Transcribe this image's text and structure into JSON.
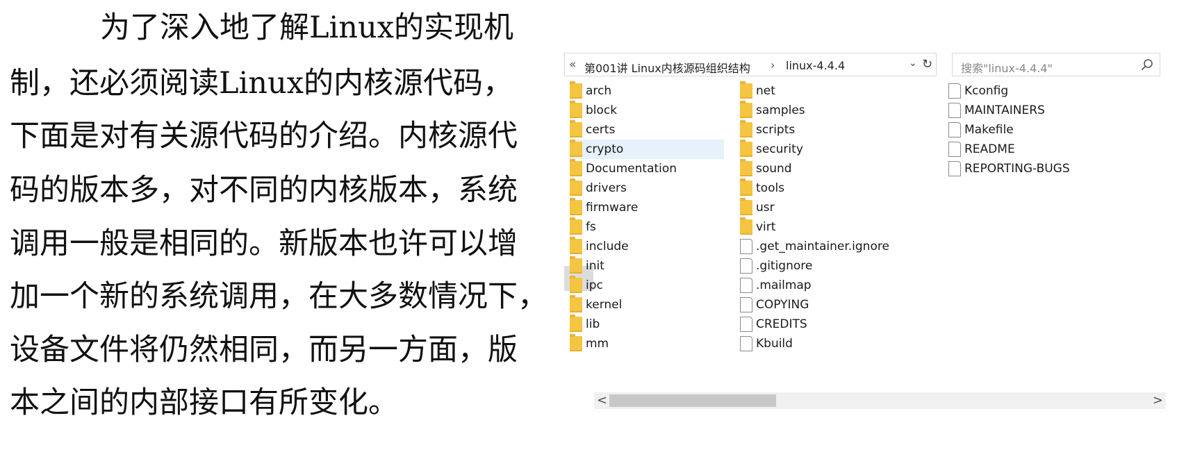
{
  "paragraph": {
    "lines": [
      "为了深入地了解Linux的实现机",
      "制，还必须阅读Linux的内核源代码，",
      "下面是对有关源代码的介绍。内核源代",
      "码的版本多，对不同的内核版本，系统",
      "调用一般是相同的。新版本也许可以增",
      "加一个新的系统调用，在大多数情况下，",
      "设备文件将仍然相同，而另一方面，版",
      "本之间的内部接口有所变化。"
    ]
  },
  "explorer": {
    "addressbar": {
      "overflow": "«",
      "crumbs": [
        "第001讲 Linux内核源码组织结构",
        "linux-4.4.4"
      ],
      "separator": "›",
      "dropdown": "⌄",
      "refresh": "↻"
    },
    "search": {
      "placeholder": "搜索\"linux-4.4.4\""
    },
    "columns": [
      [
        {
          "name": "arch",
          "type": "folder"
        },
        {
          "name": "block",
          "type": "folder"
        },
        {
          "name": "certs",
          "type": "folder"
        },
        {
          "name": "crypto",
          "type": "folder",
          "selected": true
        },
        {
          "name": "Documentation",
          "type": "folder"
        },
        {
          "name": "drivers",
          "type": "folder"
        },
        {
          "name": "firmware",
          "type": "folder"
        },
        {
          "name": "fs",
          "type": "folder"
        },
        {
          "name": "include",
          "type": "folder"
        },
        {
          "name": "init",
          "type": "folder"
        },
        {
          "name": "ipc",
          "type": "folder"
        },
        {
          "name": "kernel",
          "type": "folder"
        },
        {
          "name": "lib",
          "type": "folder"
        },
        {
          "name": "mm",
          "type": "folder"
        }
      ],
      [
        {
          "name": "net",
          "type": "folder"
        },
        {
          "name": "samples",
          "type": "folder"
        },
        {
          "name": "scripts",
          "type": "folder"
        },
        {
          "name": "security",
          "type": "folder"
        },
        {
          "name": "sound",
          "type": "folder"
        },
        {
          "name": "tools",
          "type": "folder"
        },
        {
          "name": "usr",
          "type": "folder"
        },
        {
          "name": "virt",
          "type": "folder"
        },
        {
          "name": ".get_maintainer.ignore",
          "type": "file"
        },
        {
          "name": ".gitignore",
          "type": "file"
        },
        {
          "name": ".mailmap",
          "type": "file"
        },
        {
          "name": "COPYING",
          "type": "file"
        },
        {
          "name": "CREDITS",
          "type": "file"
        },
        {
          "name": "Kbuild",
          "type": "file"
        }
      ],
      [
        {
          "name": "Kconfig",
          "type": "file"
        },
        {
          "name": "MAINTAINERS",
          "type": "file"
        },
        {
          "name": "Makefile",
          "type": "file"
        },
        {
          "name": "README",
          "type": "file"
        },
        {
          "name": "REPORTING-BUGS",
          "type": "file"
        }
      ]
    ],
    "scrollbar": {
      "left": "<",
      "right": ">"
    }
  }
}
